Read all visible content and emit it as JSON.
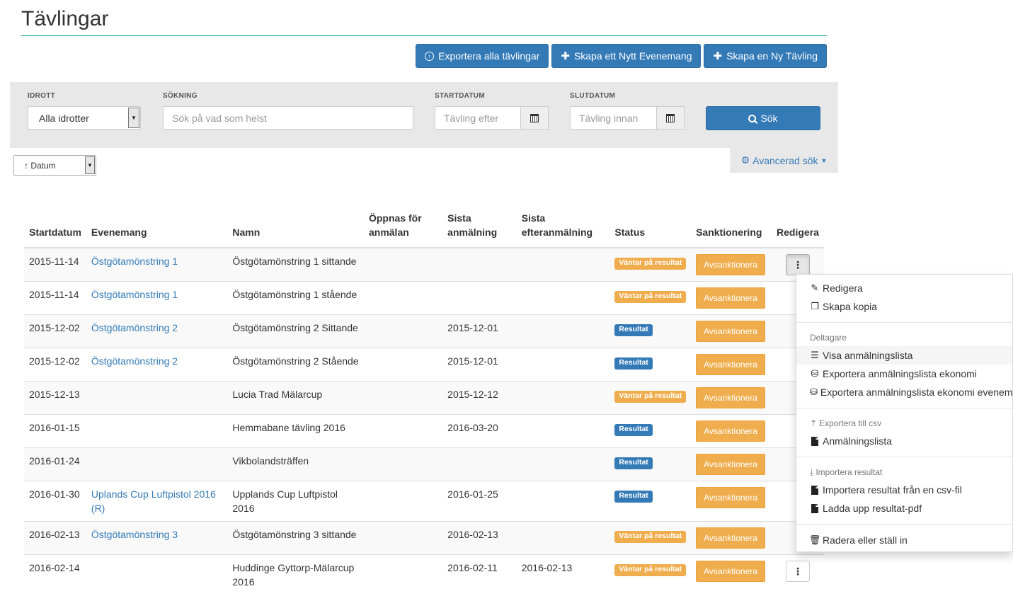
{
  "page": {
    "title": "Tävlingar"
  },
  "toolbar": {
    "export_all": "Exportera alla tävlingar",
    "create_event": "Skapa ett Nytt Evenemang",
    "create_competition": "Skapa en Ny Tävling"
  },
  "filters": {
    "sport_label": "IDROTT",
    "sport_value": "Alla idrotter",
    "search_label": "SÖKNING",
    "search_placeholder": "Sök på vad som helst",
    "start_label": "STARTDATUM",
    "start_placeholder": "Tävling efter",
    "end_label": "SLUTDATUM",
    "end_placeholder": "Tävling innan",
    "search_button": "Sök",
    "advanced": "Avancerad sök"
  },
  "sort": {
    "value": "↑ Datum"
  },
  "table": {
    "headers": {
      "start": "Startdatum",
      "event": "Evenemang",
      "name": "Namn",
      "opens": "Öppnas för anmälan",
      "last_reg": "Sista anmälning",
      "last_late": "Sista efteranmälning",
      "status": "Status",
      "sanction": "Sanktionering",
      "edit": "Redigera"
    },
    "sanction_button": "Avsanktionera",
    "rows": [
      {
        "start": "2015-11-14",
        "event": "Östgötamönstring 1",
        "name": "Östgötamönstring 1 sittande",
        "opens": "",
        "last_reg": "",
        "last_late": "",
        "status": "Väntar på resultat",
        "status_type": "warn"
      },
      {
        "start": "2015-11-14",
        "event": "Östgötamönstring 1",
        "name": "Östgötamönstring 1 stående",
        "opens": "",
        "last_reg": "",
        "last_late": "",
        "status": "Väntar på resultat",
        "status_type": "warn"
      },
      {
        "start": "2015-12-02",
        "event": "Östgötamönstring 2",
        "name": "Östgötamönstring 2 Sittande",
        "opens": "",
        "last_reg": "2015-12-01",
        "last_late": "",
        "status": "Resultat",
        "status_type": "primary"
      },
      {
        "start": "2015-12-02",
        "event": "Östgötamönstring 2",
        "name": "Östgötamönstring 2 Stående",
        "opens": "",
        "last_reg": "2015-12-01",
        "last_late": "",
        "status": "Resultat",
        "status_type": "primary"
      },
      {
        "start": "2015-12-13",
        "event": "",
        "name": "Lucia Trad Mälarcup",
        "opens": "",
        "last_reg": "2015-12-12",
        "last_late": "",
        "status": "Väntar på resultat",
        "status_type": "warn"
      },
      {
        "start": "2016-01-15",
        "event": "",
        "name": "Hemmabane tävling 2016",
        "opens": "",
        "last_reg": "2016-03-20",
        "last_late": "",
        "status": "Resultat",
        "status_type": "primary"
      },
      {
        "start": "2016-01-24",
        "event": "",
        "name": "Vikbolandsträffen",
        "opens": "",
        "last_reg": "",
        "last_late": "",
        "status": "Resultat",
        "status_type": "primary"
      },
      {
        "start": "2016-01-30",
        "event": "Uplands Cup Luftpistol 2016 (R)",
        "name": "Upplands Cup Luftpistol 2016",
        "opens": "",
        "last_reg": "2016-01-25",
        "last_late": "",
        "status": "Resultat",
        "status_type": "primary"
      },
      {
        "start": "2016-02-13",
        "event": "Östgötamönstring 3",
        "name": "Östgötamönstring 3 sittande",
        "opens": "",
        "last_reg": "2016-02-13",
        "last_late": "",
        "status": "Väntar på resultat",
        "status_type": "warn"
      },
      {
        "start": "2016-02-14",
        "event": "",
        "name": "Huddinge Gyttorp-Mälarcup 2016",
        "opens": "",
        "last_reg": "2016-02-11",
        "last_late": "2016-02-13",
        "status": "Väntar på resultat",
        "status_type": "warn"
      }
    ]
  },
  "dropdown": {
    "edit": "Redigera",
    "copy": "Skapa kopia",
    "participants_header": "Deltagare",
    "show_list": "Visa anmälningslista",
    "export_economy": "Exportera anmälningslista ekonomi",
    "export_economy_event": "Exportera anmälningslista ekonomi evenemang",
    "export_csv_header": "Exportera till csv",
    "registration_list": "Anmälningslista",
    "import_header": "Importera resultat",
    "import_csv": "Importera resultat från en csv-fil",
    "upload_pdf": "Ladda upp resultat-pdf",
    "delete": "Radera eller ställ in"
  }
}
